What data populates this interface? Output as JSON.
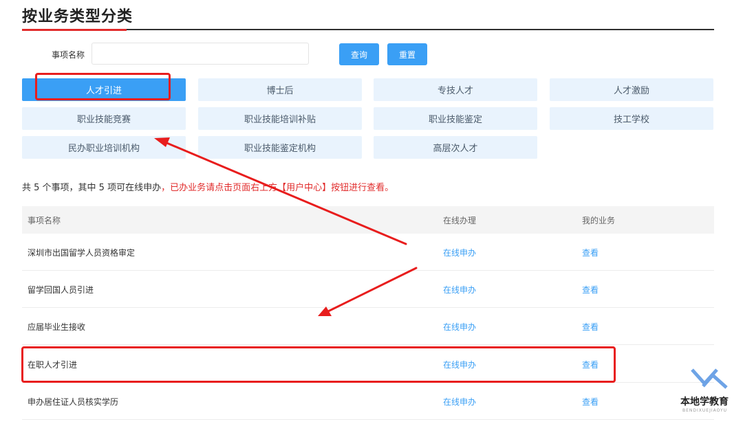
{
  "page_title": "按业务类型分类",
  "search": {
    "label": "事项名称",
    "value": "",
    "placeholder": ""
  },
  "buttons": {
    "query": "查询",
    "reset": "重置"
  },
  "categories": [
    {
      "label": "人才引进",
      "active": true
    },
    {
      "label": "博士后"
    },
    {
      "label": "专技人才"
    },
    {
      "label": "人才激励"
    },
    {
      "label": "职业技能竞赛"
    },
    {
      "label": "职业技能培训补贴"
    },
    {
      "label": "职业技能鉴定"
    },
    {
      "label": "技工学校"
    },
    {
      "label": "民办职业培训机构"
    },
    {
      "label": "职业技能鉴定机构"
    },
    {
      "label": "高层次人才"
    }
  ],
  "summary": {
    "main": "共 5 个事项，其中 5 项可在线申办",
    "notice": "，已办业务请点击页面右上方【用户中心】按钮进行查看。"
  },
  "table": {
    "headers": [
      "事项名称",
      "在线办理",
      "我的业务"
    ],
    "rows": [
      {
        "name": "深圳市出国留学人员资格审定",
        "online": "在线申办",
        "mine": "查看"
      },
      {
        "name": "留学回国人员引进",
        "online": "在线申办",
        "mine": "查看"
      },
      {
        "name": "应届毕业生接收",
        "online": "在线申办",
        "mine": "查看"
      },
      {
        "name": "在职人才引进",
        "online": "在线申办",
        "mine": "查看"
      },
      {
        "name": "申办居住证人员核实学历",
        "online": "在线申办",
        "mine": "查看"
      }
    ]
  },
  "watermark": {
    "name": "本地学教育",
    "sub": "BENDIXUEJIAOYU"
  },
  "colors": {
    "accent_blue": "#3a9ff5",
    "highlight_red": "#e81d1d",
    "tab_bg": "#e9f3fd"
  }
}
